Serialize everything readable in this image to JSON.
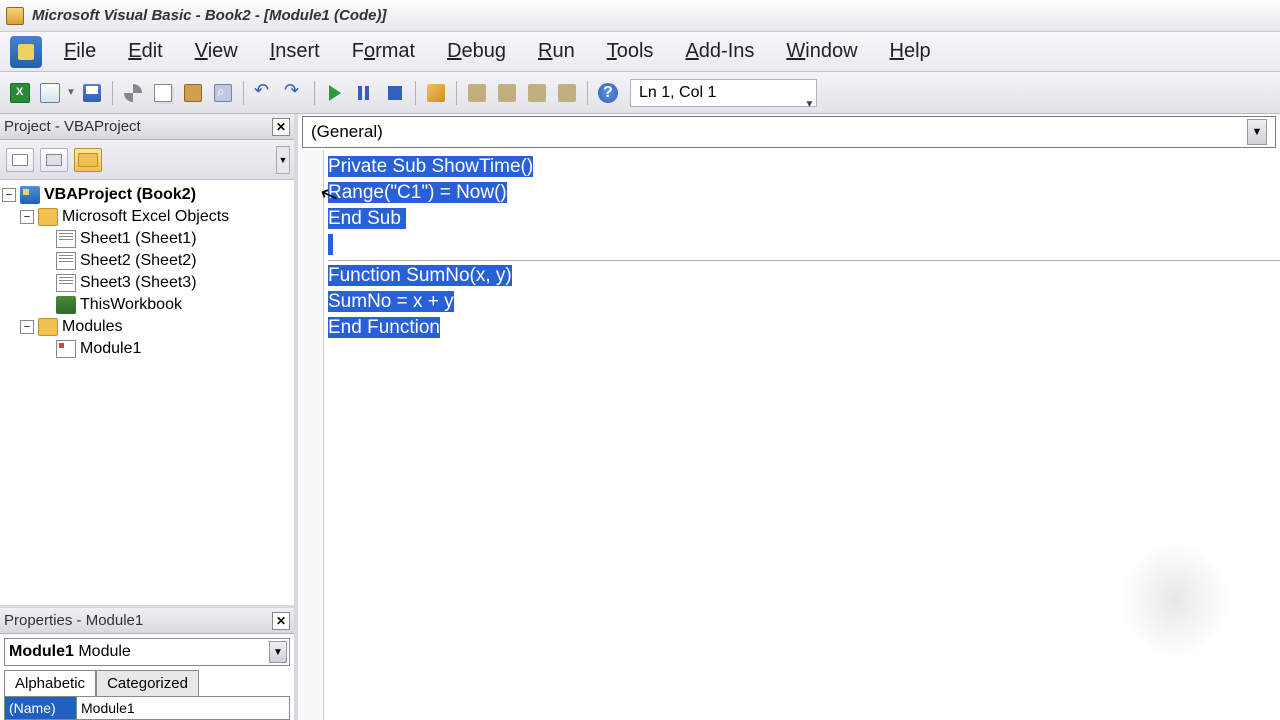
{
  "titlebar": {
    "text": "Microsoft Visual Basic - Book2 - [Module1 (Code)]"
  },
  "menu": {
    "items": [
      "File",
      "Edit",
      "View",
      "Insert",
      "Format",
      "Debug",
      "Run",
      "Tools",
      "Add-Ins",
      "Window",
      "Help"
    ]
  },
  "toolbar": {
    "cursor_pos": "Ln 1, Col 1"
  },
  "project_panel": {
    "title": "Project - VBAProject",
    "root": "VBAProject (Book2)",
    "folder1": "Microsoft Excel Objects",
    "sheets": [
      "Sheet1 (Sheet1)",
      "Sheet2 (Sheet2)",
      "Sheet3 (Sheet3)"
    ],
    "workbook": "ThisWorkbook",
    "folder2": "Modules",
    "module": "Module1"
  },
  "props_panel": {
    "title": "Properties - Module1",
    "object": "Module1",
    "object_type": "Module",
    "tabs": [
      "Alphabetic",
      "Categorized"
    ],
    "name_label": "(Name)",
    "name_value": "Module1"
  },
  "code": {
    "dropdown": "(General)",
    "lines": [
      "Private Sub ShowTime()",
      "Range(\"C1\") = Now()",
      "End Sub ",
      " ",
      "Function SumNo(x, y)",
      "SumNo = x + y",
      "End Function"
    ]
  }
}
